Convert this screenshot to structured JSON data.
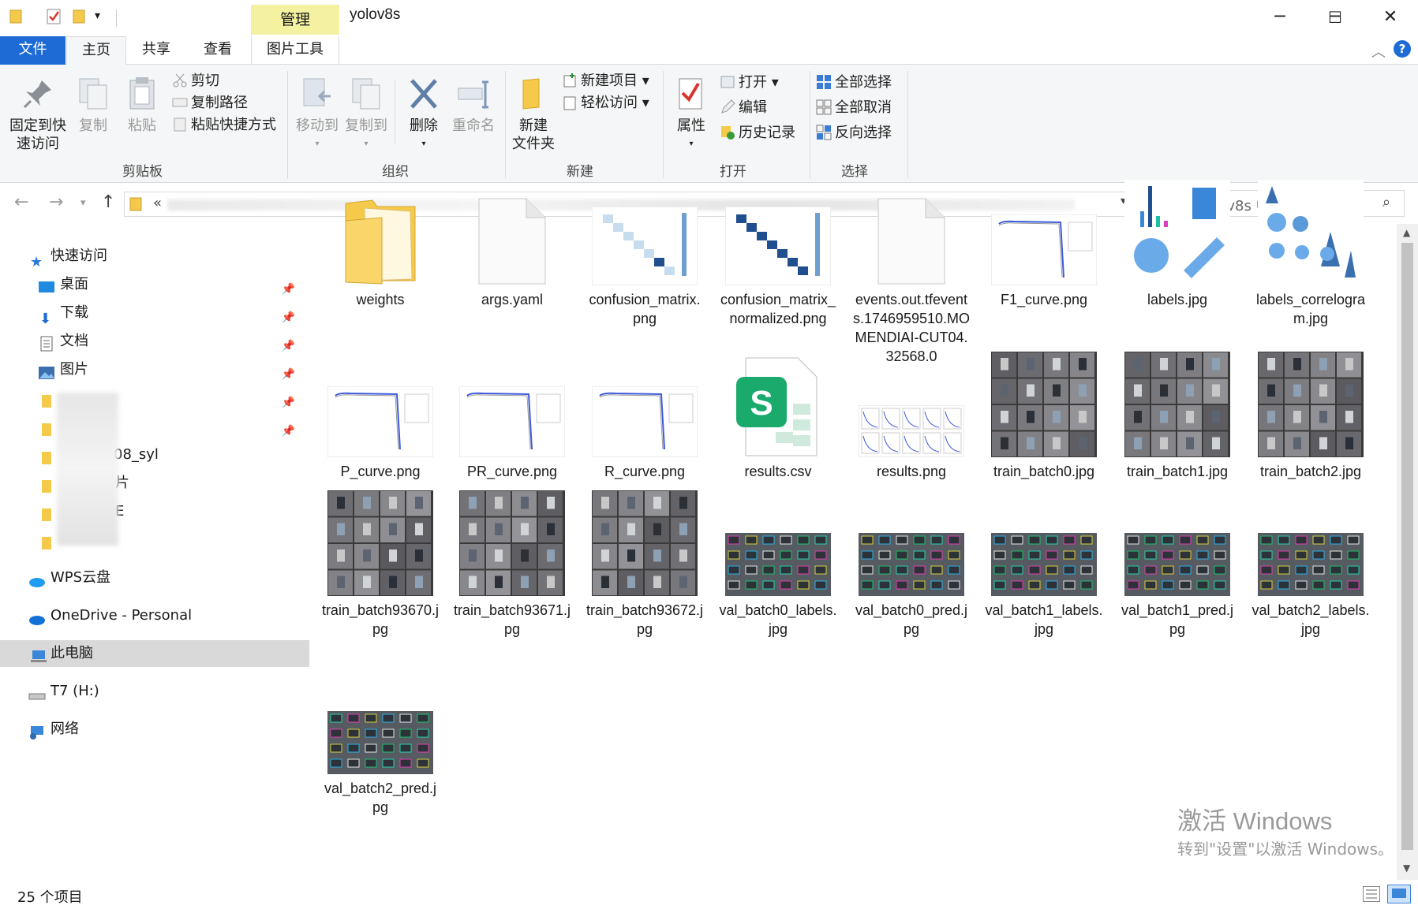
{
  "window": {
    "title": "yolov8s",
    "context_tab": "管理",
    "minimize": "─",
    "maximize": "☐",
    "close": "✕"
  },
  "tabs": {
    "file": "文件",
    "home": "主页",
    "share": "共享",
    "view": "查看",
    "picture_tools": "图片工具"
  },
  "ribbon": {
    "clipboard": {
      "group": "剪贴板",
      "pin": "固定到快速访问",
      "copy": "复制",
      "paste": "粘贴",
      "cut": "剪切",
      "copy_path": "复制路径",
      "paste_shortcut": "粘贴快捷方式"
    },
    "organize": {
      "group": "组织",
      "move_to": "移动到",
      "copy_to": "复制到",
      "delete": "删除",
      "rename": "重命名"
    },
    "new": {
      "group": "新建",
      "new_folder": "新建文件夹",
      "new_item": "新建项目",
      "easy_access": "轻松访问"
    },
    "open": {
      "group": "打开",
      "properties": "属性",
      "open": "打开",
      "edit": "编辑",
      "history": "历史记录"
    },
    "select": {
      "group": "选择",
      "select_all": "全部选择",
      "select_none": "全部取消",
      "invert": "反向选择"
    }
  },
  "address": {
    "prefix": "«",
    "search_placeholder": "在 yolov8s 中搜索"
  },
  "nav": {
    "quick_access": "快速访问",
    "pinned": [
      "桌面",
      "下载",
      "文档",
      "图片"
    ],
    "partial": [
      "08_syl",
      "片",
      "E"
    ],
    "wps": "WPS云盘",
    "onedrive": "OneDrive - Personal",
    "this_pc": "此电脑",
    "t7": "T7 (H:)",
    "network": "网络"
  },
  "files": [
    {
      "name": "weights",
      "kind": "folder"
    },
    {
      "name": "args.yaml",
      "kind": "doc"
    },
    {
      "name": "confusion_matrix.png",
      "kind": "cm"
    },
    {
      "name": "confusion_matrix_normalized.png",
      "kind": "cmn"
    },
    {
      "name": "events.out.tfevents.1746959510.MOMENDIAI-CUT04.32568.0",
      "kind": "doc"
    },
    {
      "name": "F1_curve.png",
      "kind": "curve"
    },
    {
      "name": "labels.jpg",
      "kind": "labels"
    },
    {
      "name": "labels_correlogram.jpg",
      "kind": "correlogram"
    },
    {
      "name": "P_curve.png",
      "kind": "curve"
    },
    {
      "name": "PR_curve.png",
      "kind": "curve"
    },
    {
      "name": "R_curve.png",
      "kind": "curve"
    },
    {
      "name": "results.csv",
      "kind": "csv"
    },
    {
      "name": "results.png",
      "kind": "results"
    },
    {
      "name": "train_batch0.jpg",
      "kind": "batch"
    },
    {
      "name": "train_batch1.jpg",
      "kind": "batch"
    },
    {
      "name": "train_batch2.jpg",
      "kind": "batch"
    },
    {
      "name": "train_batch93670.jpg",
      "kind": "batch"
    },
    {
      "name": "train_batch93671.jpg",
      "kind": "batch"
    },
    {
      "name": "train_batch93672.jpg",
      "kind": "batch"
    },
    {
      "name": "val_batch0_labels.jpg",
      "kind": "val"
    },
    {
      "name": "val_batch0_pred.jpg",
      "kind": "val"
    },
    {
      "name": "val_batch1_labels.jpg",
      "kind": "val"
    },
    {
      "name": "val_batch1_pred.jpg",
      "kind": "val"
    },
    {
      "name": "val_batch2_labels.jpg",
      "kind": "val"
    },
    {
      "name": "val_batch2_pred.jpg",
      "kind": "val"
    }
  ],
  "status": {
    "count": "25 个项目"
  },
  "watermark": {
    "line1": "激活 Windows",
    "line2": "转到\"设置\"以激活 Windows。"
  },
  "colors": {
    "accent": "#1e6bd6",
    "context_tab": "#f4f1a0",
    "folder": "#f5c94a"
  }
}
